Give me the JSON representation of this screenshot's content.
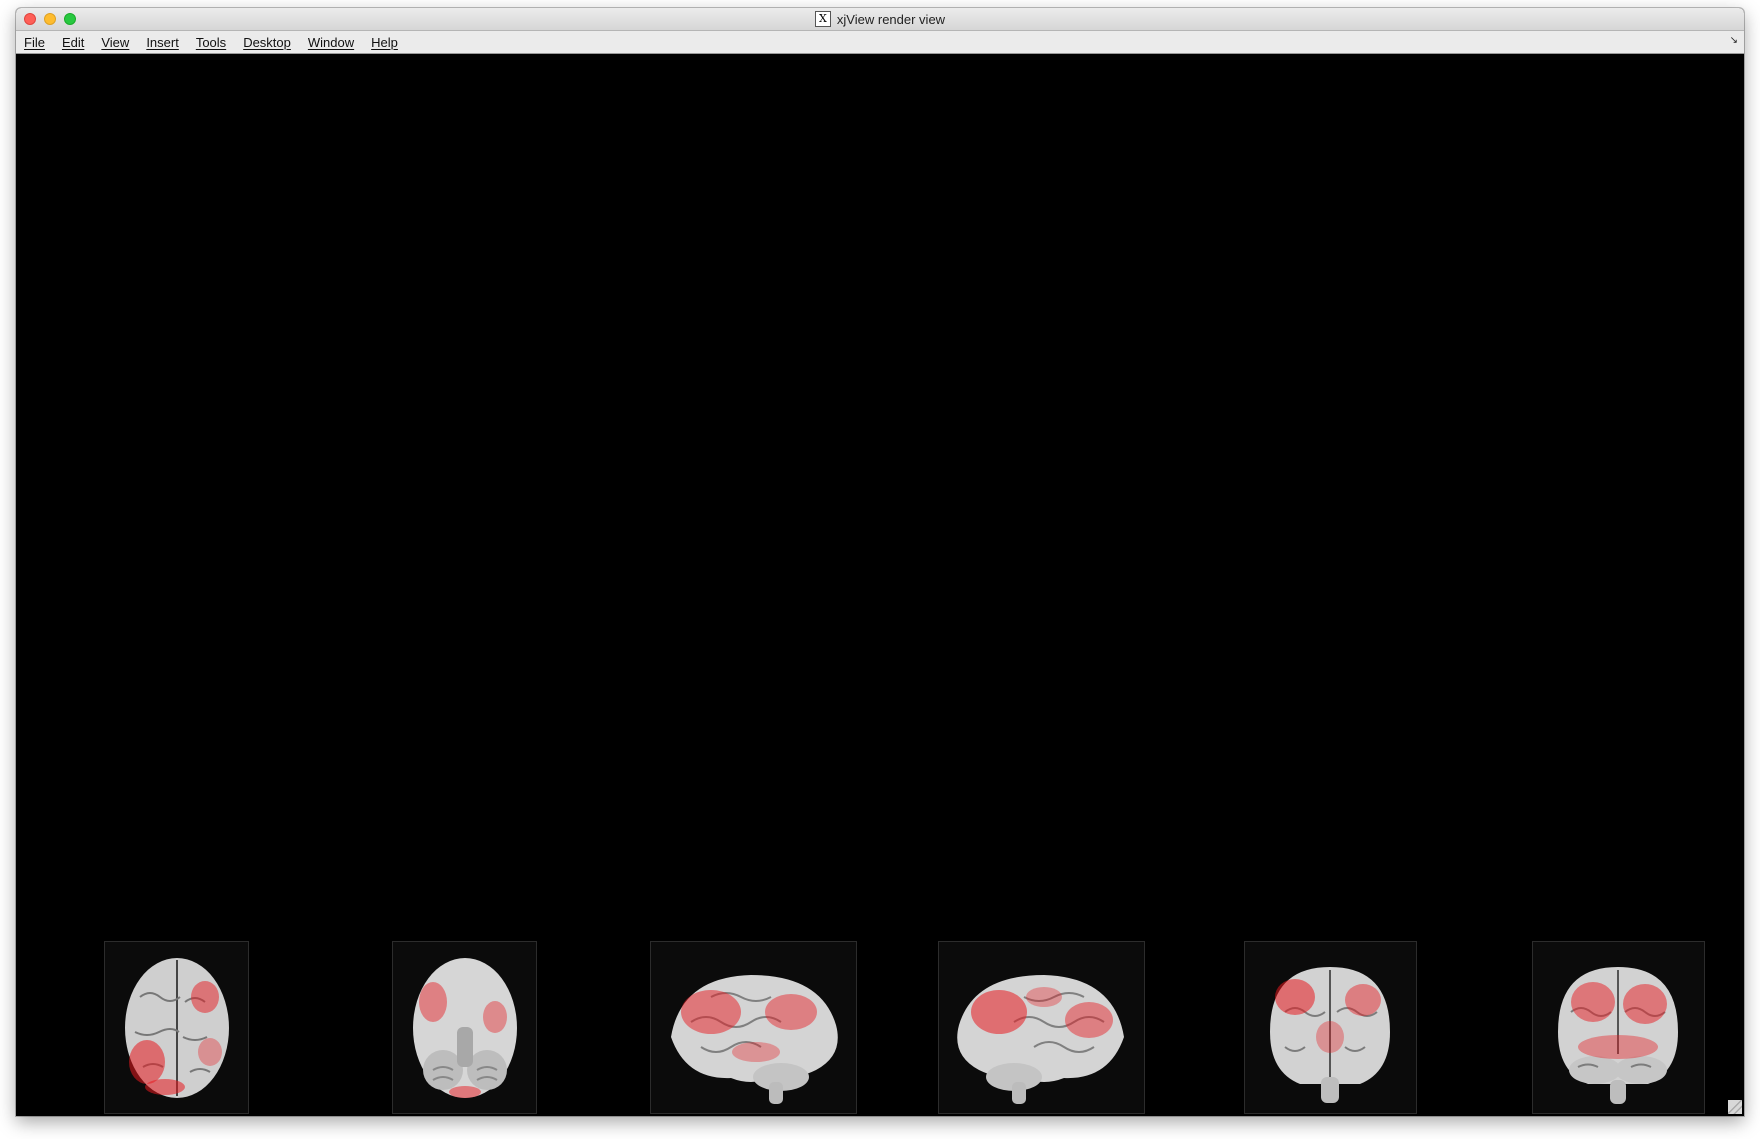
{
  "window": {
    "title": "xjView render view",
    "title_icon": "x11-icon"
  },
  "menubar": {
    "items": [
      {
        "label": "File"
      },
      {
        "label": "Edit"
      },
      {
        "label": "View"
      },
      {
        "label": "Insert"
      },
      {
        "label": "Tools"
      },
      {
        "label": "Desktop"
      },
      {
        "label": "Window"
      },
      {
        "label": "Help"
      }
    ],
    "dock_icon": "dock-arrow-icon"
  },
  "render": {
    "background_color": "#000000",
    "surface_color": "#d9d9d9",
    "activation_color": "#e8191f",
    "views": [
      {
        "name": "superior"
      },
      {
        "name": "inferior"
      },
      {
        "name": "left-lateral"
      },
      {
        "name": "right-lateral"
      },
      {
        "name": "anterior"
      },
      {
        "name": "posterior"
      }
    ]
  }
}
